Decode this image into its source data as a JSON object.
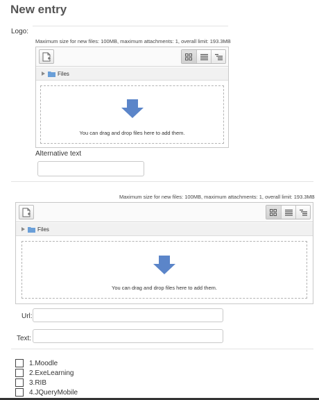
{
  "page": {
    "title": "New entry"
  },
  "logo_section": {
    "label": "Logo:",
    "limits": "Maximum size for new files: 100MB, maximum attachments: 1, overall limit: 193.3MB",
    "path_label": "Files",
    "drop_text": "You can drag and drop files here to add them.",
    "alt_label": "Alternative text",
    "alt_value": ""
  },
  "media_section": {
    "limits": "Maximum size for new files: 100MB, maximum attachments: 1, overall limit: 193.3MB",
    "path_label": "Files",
    "drop_text": "You can drag and drop files here to add them.",
    "url_label": "Url:",
    "url_value": "",
    "text_label": "Text:",
    "text_value": ""
  },
  "options": [
    {
      "label": "1.Moodle",
      "checked": false
    },
    {
      "label": "2.ExeLearning",
      "checked": false
    },
    {
      "label": "3.RIB",
      "checked": false
    },
    {
      "label": "4.JQueryMobile",
      "checked": false
    }
  ],
  "icons": [
    "add-file-icon",
    "icon-view-icon",
    "list-view-icon",
    "tree-view-icon",
    "folder-icon",
    "drop-arrow-icon"
  ],
  "colors": {
    "drop_arrow": "#5b85c9",
    "folder": "#6a9fd8",
    "border": "#c8c8c8"
  }
}
